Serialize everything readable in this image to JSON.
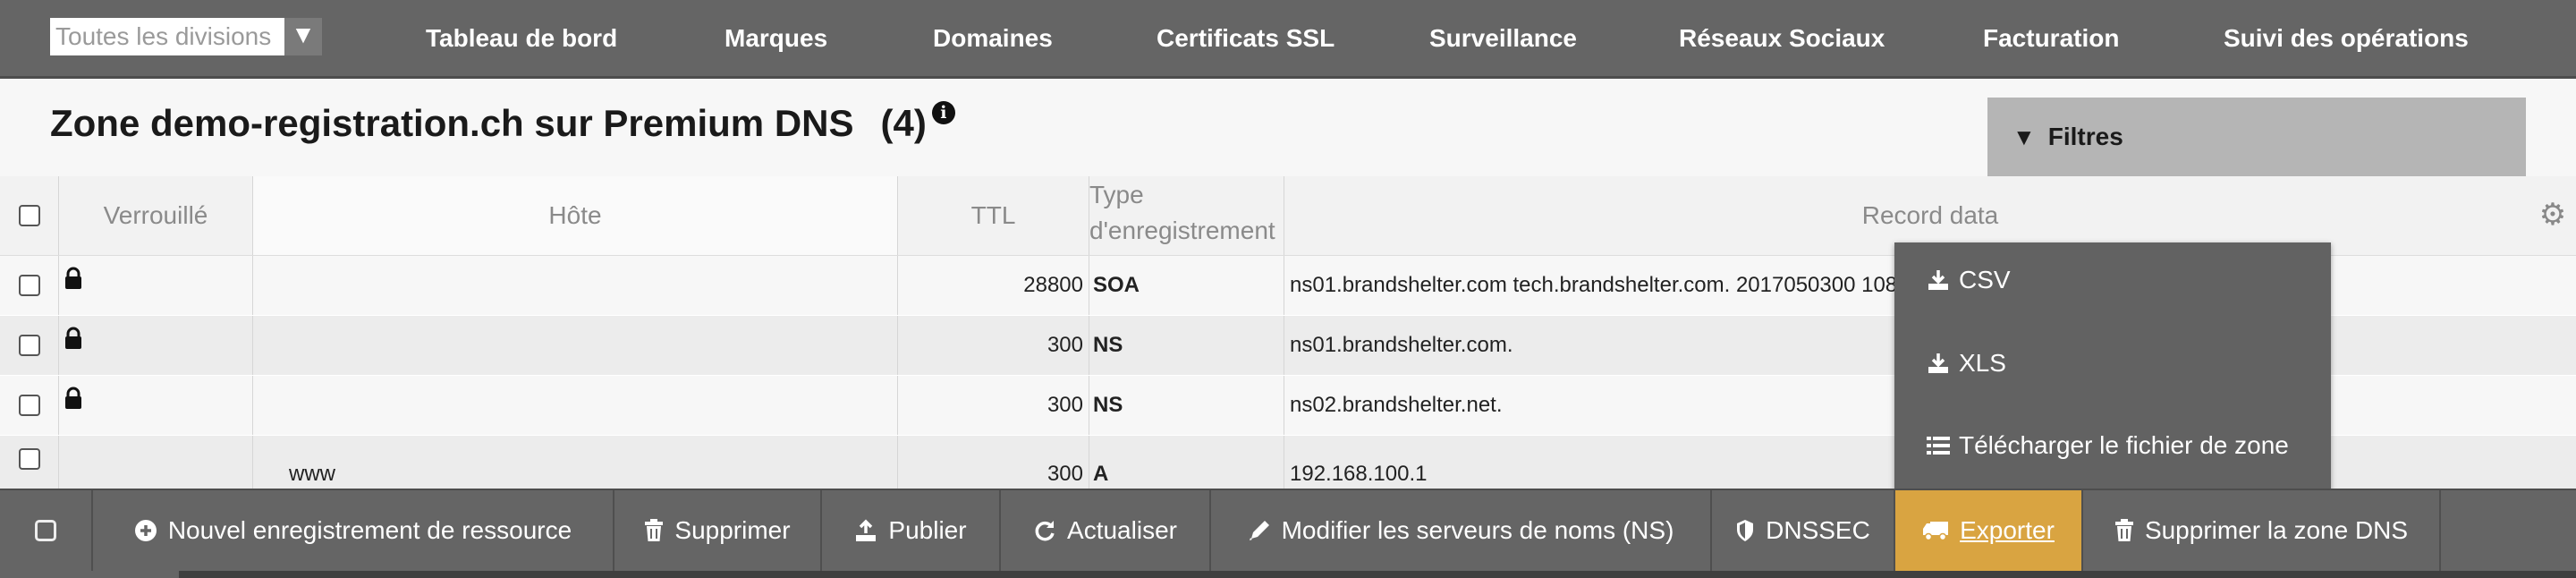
{
  "nav": {
    "division": {
      "value": "Toutes les divisions",
      "caret": "▼"
    },
    "items": [
      "Tableau de bord",
      "Marques",
      "Domaines",
      "Certificats SSL",
      "Surveillance",
      "Réseaux Sociaux",
      "Facturation",
      "Suivi des opérations"
    ]
  },
  "page": {
    "title": "Zone demo-registration.ch sur Premium DNS",
    "count": "(4)",
    "info_icon": "i"
  },
  "filters": {
    "label": "Filtres",
    "icon": "triangle-down"
  },
  "table": {
    "headers": {
      "locked": "Verrouillé",
      "host": "Hôte",
      "ttl": "TTL",
      "type_line1": "Type",
      "type_line2": "d'enregistrement",
      "data": "Record data"
    },
    "rows": [
      {
        "locked": true,
        "host": "",
        "ttl": "28800",
        "type": "SOA",
        "data": "ns01.brandshelter.com tech.brandshelter.com. 2017050300 108"
      },
      {
        "locked": true,
        "host": "",
        "ttl": "300",
        "type": "NS",
        "data": "ns01.brandshelter.com."
      },
      {
        "locked": true,
        "host": "",
        "ttl": "300",
        "type": "NS",
        "data": "ns02.brandshelter.net."
      },
      {
        "locked": false,
        "host": "www",
        "ttl": "300",
        "type": "A",
        "data": "192.168.100.1"
      }
    ]
  },
  "export_menu": {
    "items": [
      {
        "label": "CSV",
        "icon": "download-icon"
      },
      {
        "label": "XLS",
        "icon": "download-icon"
      },
      {
        "label": "Télécharger le fichier de zone",
        "icon": "list-icon"
      }
    ]
  },
  "toolbar": {
    "new_record": "Nouvel enregistrement de ressource",
    "delete": "Supprimer",
    "publish": "Publier",
    "refresh": "Actualiser",
    "edit_ns": "Modifier les serveurs de noms (NS)",
    "dnssec": "DNSSEC",
    "export": "Exporter",
    "delete_zone": "Supprimer la zone DNS"
  },
  "colors": {
    "nav_bg": "#656565",
    "active_button": "#d9a441",
    "menu_bg": "#626262",
    "filters_bg": "#b5b5b5"
  }
}
